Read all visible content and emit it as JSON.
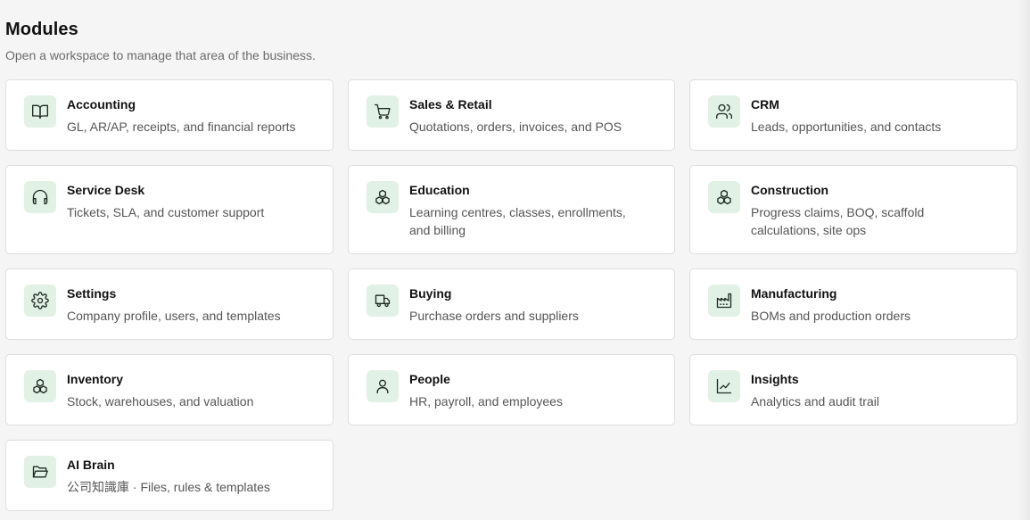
{
  "header": {
    "title": "Modules",
    "subtitle": "Open a workspace to manage that area of the business."
  },
  "modules": [
    {
      "title": "Accounting",
      "desc": "GL, AR/AP, receipts, and financial reports",
      "icon": "book-open-icon"
    },
    {
      "title": "Sales & Retail",
      "desc": "Quotations, orders, invoices, and POS",
      "icon": "shopping-cart-icon"
    },
    {
      "title": "CRM",
      "desc": "Leads, opportunities, and contacts",
      "icon": "users-icon"
    },
    {
      "title": "Service Desk",
      "desc": "Tickets, SLA, and customer support",
      "icon": "headphones-icon"
    },
    {
      "title": "Education",
      "desc": "Learning centres, classes, enrollments, and billing",
      "icon": "boxes-icon"
    },
    {
      "title": "Construction",
      "desc": "Progress claims, BOQ, scaffold calculations, site ops",
      "icon": "boxes-icon"
    },
    {
      "title": "Settings",
      "desc": "Company profile, users, and templates",
      "icon": "gear-icon"
    },
    {
      "title": "Buying",
      "desc": "Purchase orders and suppliers",
      "icon": "truck-icon"
    },
    {
      "title": "Manufacturing",
      "desc": "BOMs and production orders",
      "icon": "factory-icon"
    },
    {
      "title": "Inventory",
      "desc": "Stock, warehouses, and valuation",
      "icon": "boxes-icon"
    },
    {
      "title": "People",
      "desc": "HR, payroll, and employees",
      "icon": "user-icon"
    },
    {
      "title": "Insights",
      "desc": "Analytics and audit trail",
      "icon": "line-chart-icon"
    },
    {
      "title": "AI Brain",
      "desc": "公司知識庫 · Files, rules & templates",
      "icon": "folder-open-icon"
    }
  ]
}
